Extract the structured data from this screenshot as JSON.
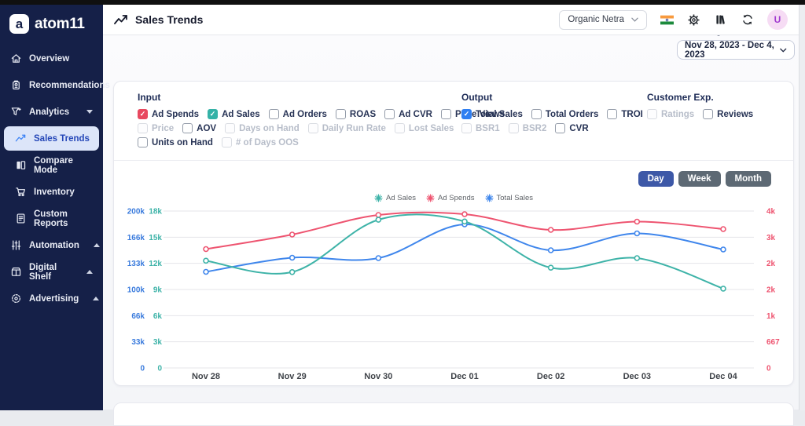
{
  "brand": {
    "name": "atom11",
    "logo_letter": "a"
  },
  "sidebar": {
    "items": [
      {
        "label": "Overview",
        "icon": "home",
        "sub": false,
        "active": false,
        "chevron": null
      },
      {
        "label": "Recommendations",
        "icon": "package",
        "sub": false,
        "active": false,
        "chevron": null
      },
      {
        "label": "Analytics",
        "icon": "funnel",
        "sub": false,
        "active": false,
        "chevron": "down"
      },
      {
        "label": "Sales Trends",
        "icon": "trend",
        "sub": true,
        "active": true,
        "chevron": null
      },
      {
        "label": "Compare Mode",
        "icon": "compare",
        "sub": true,
        "active": false,
        "chevron": null
      },
      {
        "label": "Inventory",
        "icon": "cart",
        "sub": true,
        "active": false,
        "chevron": null
      },
      {
        "label": "Custom Reports",
        "icon": "report",
        "sub": true,
        "active": false,
        "chevron": null
      },
      {
        "label": "Automation",
        "icon": "sliders",
        "sub": false,
        "active": false,
        "chevron": "up"
      },
      {
        "label": "Digital Shelf",
        "icon": "shelf",
        "sub": false,
        "active": false,
        "chevron": "up"
      },
      {
        "label": "Advertising",
        "icon": "ad",
        "sub": false,
        "active": false,
        "chevron": "up"
      }
    ]
  },
  "header": {
    "title": "Sales Trends",
    "account_selector": "Organic Netra",
    "icons": [
      "india-flag-icon",
      "settings-gear-icon",
      "library-icon",
      "refresh-icon"
    ],
    "avatar_letter": "U"
  },
  "date_range": {
    "label": "Date Range",
    "value": "Nov 28, 2023 - Dec 4, 2023"
  },
  "filters": {
    "input": {
      "title": "Input",
      "rows": [
        [
          {
            "label": "Ad Spends",
            "checked": true,
            "disabled": false,
            "color": "#e8485f"
          },
          {
            "label": "Ad Sales",
            "checked": true,
            "disabled": false,
            "color": "#35b2a7"
          },
          {
            "label": "Ad Orders",
            "checked": false,
            "disabled": false
          },
          {
            "label": "ROAS",
            "checked": false,
            "disabled": false
          },
          {
            "label": "Ad CVR",
            "checked": false,
            "disabled": false
          },
          {
            "label": "Page Views",
            "checked": false,
            "disabled": false
          }
        ],
        [
          {
            "label": "Price",
            "checked": false,
            "disabled": true
          },
          {
            "label": "AOV",
            "checked": false,
            "disabled": false
          },
          {
            "label": "Days on Hand",
            "checked": false,
            "disabled": true
          },
          {
            "label": "Daily Run Rate",
            "checked": false,
            "disabled": true
          },
          {
            "label": "Lost Sales",
            "checked": false,
            "disabled": true
          }
        ],
        [
          {
            "label": "Units on Hand",
            "checked": false,
            "disabled": false
          },
          {
            "label": "# of Days OOS",
            "checked": false,
            "disabled": true
          }
        ]
      ]
    },
    "output": {
      "title": "Output",
      "rows": [
        [
          {
            "label": "Total Sales",
            "checked": true,
            "disabled": false,
            "color": "#2f7ff2"
          },
          {
            "label": "Total Orders",
            "checked": false,
            "disabled": false
          },
          {
            "label": "TROI",
            "checked": false,
            "disabled": false
          }
        ],
        [
          {
            "label": "BSR1",
            "checked": false,
            "disabled": true
          },
          {
            "label": "BSR2",
            "checked": false,
            "disabled": true
          },
          {
            "label": "CVR",
            "checked": false,
            "disabled": false
          }
        ]
      ]
    },
    "customer_exp": {
      "title": "Customer Exp.",
      "rows": [
        [
          {
            "label": "Ratings",
            "checked": false,
            "disabled": true
          },
          {
            "label": "Reviews",
            "checked": false,
            "disabled": false
          }
        ]
      ]
    }
  },
  "granularity": {
    "options": [
      "Day",
      "Week",
      "Month"
    ],
    "selected": "Day"
  },
  "chart_data": {
    "type": "line",
    "x": [
      "Nov 28",
      "Nov 29",
      "Nov 30",
      "Dec 01",
      "Dec 02",
      "Dec 03",
      "Dec 04"
    ],
    "series": [
      {
        "name": "Ad Sales",
        "color": "#3eb3a8",
        "axis": "ad_sales",
        "values": [
          12300,
          11000,
          17000,
          16800,
          11500,
          12600,
          9100
        ]
      },
      {
        "name": "Ad Spends",
        "color": "#ee5470",
        "axis": "ad_spends",
        "values": [
          3030,
          3400,
          3900,
          3920,
          3520,
          3730,
          3540
        ]
      },
      {
        "name": "Total Sales",
        "color": "#3f86ec",
        "axis": "total_sales",
        "values": [
          122500,
          140500,
          140000,
          183000,
          150000,
          171500,
          151000
        ]
      }
    ],
    "axes": {
      "total_sales": {
        "position": "left-outer",
        "color": "#3a7bdd",
        "max": 200000,
        "ticks": [
          "200k",
          "166k",
          "133k",
          "100k",
          "66k",
          "33k",
          "0"
        ]
      },
      "ad_sales": {
        "position": "left-inner",
        "color": "#3eb3a8",
        "max": 18000,
        "ticks": [
          "18k",
          "15k",
          "12k",
          "9k",
          "6k",
          "3k",
          "0"
        ]
      },
      "ad_spends": {
        "position": "right",
        "color": "#ee5470",
        "max": 4000,
        "ticks": [
          "4k",
          "3k",
          "2k",
          "2k",
          "1k",
          "667",
          "0"
        ]
      }
    },
    "legend": [
      "Ad Sales",
      "Ad Spends",
      "Total Sales"
    ],
    "grid": true,
    "legend_position": "top-center"
  }
}
